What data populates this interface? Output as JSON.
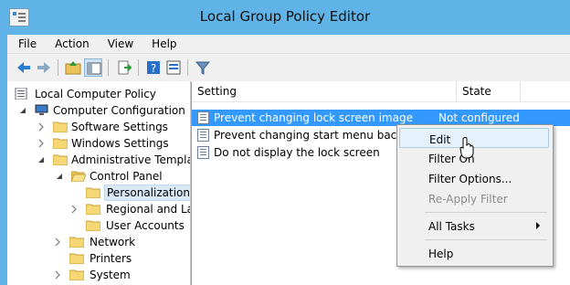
{
  "window": {
    "title": "Local Group Policy Editor"
  },
  "menu": [
    "File",
    "Action",
    "View",
    "Help"
  ],
  "toolbar_icons": [
    "back-arrow-icon",
    "forward-arrow-icon",
    "up-folder-icon",
    "show-hide-tree-icon",
    "export-list-icon",
    "help-icon",
    "properties-icon",
    "filter-icon"
  ],
  "tree": [
    {
      "label": "Local Computer Policy",
      "icon": "computer-policy-icon",
      "arrow": "none"
    },
    {
      "label": "Computer Configuration",
      "icon": "computer-icon",
      "arrow": "expanded"
    },
    {
      "label": "Software Settings",
      "icon": "folder-icon",
      "arrow": "collapsed"
    },
    {
      "label": "Windows Settings",
      "icon": "folder-icon",
      "arrow": "collapsed"
    },
    {
      "label": "Administrative Templates",
      "icon": "folder-icon",
      "arrow": "expanded"
    },
    {
      "label": "Control Panel",
      "icon": "folder-open-icon",
      "arrow": "expanded"
    },
    {
      "label": "Personalization",
      "icon": "folder-icon",
      "arrow": "none",
      "selected": true
    },
    {
      "label": "Regional and Language",
      "icon": "folder-icon",
      "arrow": "collapsed"
    },
    {
      "label": "User Accounts",
      "icon": "folder-icon",
      "arrow": "none"
    },
    {
      "label": "Network",
      "icon": "folder-icon",
      "arrow": "collapsed"
    },
    {
      "label": "Printers",
      "icon": "folder-icon",
      "arrow": "none"
    },
    {
      "label": "System",
      "icon": "folder-icon",
      "arrow": "collapsed"
    }
  ],
  "list": {
    "columns": [
      "Setting",
      "State"
    ],
    "rows": [
      {
        "setting": "Prevent changing lock screen image",
        "state": "Not configured",
        "selected": true
      },
      {
        "setting": "Prevent changing start menu background",
        "state": ""
      },
      {
        "setting": "Do not display the lock screen",
        "state": ""
      }
    ]
  },
  "context_menu": {
    "items": [
      {
        "label": "Edit",
        "hover": true
      },
      {
        "label": "Filter On"
      },
      {
        "label": "Filter Options..."
      },
      {
        "label": "Re-Apply Filter",
        "disabled": true
      },
      {
        "label": "All Tasks",
        "submenu": true
      },
      {
        "label": "Help"
      }
    ]
  },
  "colors": {
    "titlebar": "#5fb3e6",
    "selection": "#3399ff",
    "menu_hover": "#e5f1fb"
  }
}
